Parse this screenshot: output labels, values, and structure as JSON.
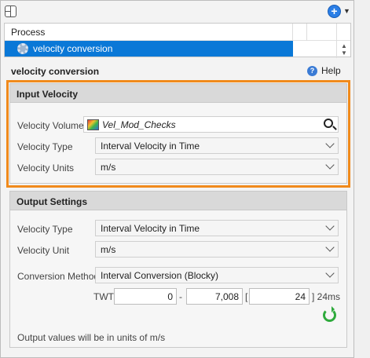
{
  "process_table": {
    "header": "Process",
    "selected_item": "velocity conversion"
  },
  "panel": {
    "title": "velocity conversion",
    "help_label": "Help"
  },
  "input_velocity": {
    "group_title": "Input Velocity",
    "volume_label": "Velocity Volume",
    "volume_value": "Vel_Mod_Checks",
    "type_label": "Velocity Type",
    "type_value": "Interval Velocity in Time",
    "units_label": "Velocity Units",
    "units_value": "m/s"
  },
  "output_settings": {
    "group_title": "Output Settings",
    "type_label": "Velocity Type",
    "type_value": "Interval Velocity in Time",
    "unit_label": "Velocity Unit",
    "unit_value": "m/s",
    "method_label": "Conversion Method",
    "method_value": "Interval Conversion (Blocky)",
    "twt_label": "TWT",
    "twt_start": "0",
    "twt_dash": "-",
    "twt_end": "7,008",
    "twt_bracket": "[",
    "twt_step": "24",
    "twt_step_unit": "] 24ms",
    "note": "Output values will be in units of m/s"
  },
  "colors": {
    "selection": "#0a78d7",
    "highlight": "#f08a1c"
  }
}
